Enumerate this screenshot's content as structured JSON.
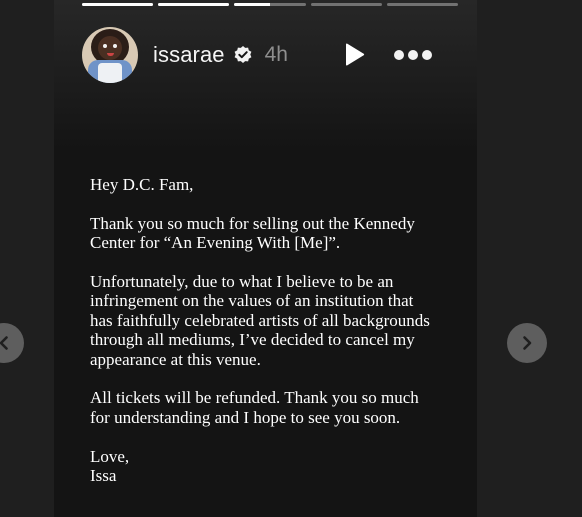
{
  "story": {
    "username": "issarae",
    "timestamp": "4h",
    "progress": [
      1,
      1,
      0.5,
      0,
      0
    ],
    "letter": {
      "greeting": "Hey D.C. Fam,",
      "paragraph1": "Thank you so much for selling out the Kennedy\nCenter for “An Evening With [Me]”.",
      "paragraph2": "Unfortunately, due to what I believe to be an\ninfringement on the values of an institution that\nhas faithfully celebrated artists of all backgrounds\nthrough all mediums, I’ve decided to cancel my\nappearance at this venue.",
      "paragraph3": "All tickets will be refunded. Thank you so much\nfor understanding and I hope to see you soon.",
      "signoff": "Love,\nIssa"
    }
  },
  "icons": {
    "verified": "verified-badge-icon",
    "play": "play-icon",
    "more": "more-options-icon",
    "prev": "chevron-left-icon",
    "next": "chevron-right-icon"
  },
  "colors": {
    "page_background": "#1f1f1f",
    "story_background": "#141414",
    "text": "#ffffff",
    "timestamp": "#8e8e8e",
    "nav_arrow": "#5e5e5e"
  }
}
